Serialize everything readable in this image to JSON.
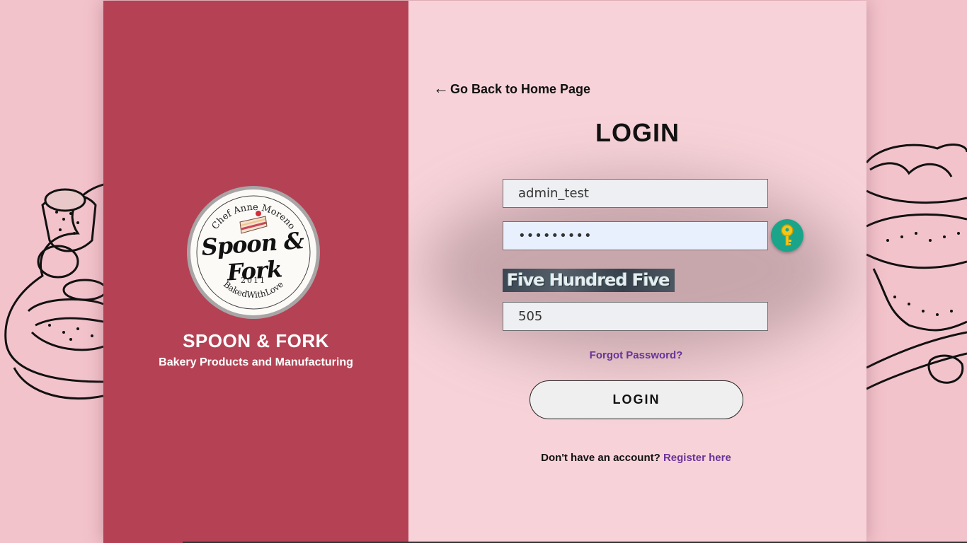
{
  "brand": {
    "logo": {
      "arc_top": "Chef Anne Moreno",
      "script": "Spoon & Fork",
      "year": "2011",
      "arc_bottom": "BakedWithLove"
    },
    "name": "SPOON & FORK",
    "tagline": "Bakery Products and Manufacturing",
    "color": "#b54254"
  },
  "form": {
    "back_link": "Go Back to Home Page",
    "back_arrow": "←",
    "title": "LOGIN",
    "username_value": "admin_test",
    "password_value": "•••••••••",
    "password_toggle_icon": "key-icon",
    "captcha_text": "Five Hundred Five",
    "captcha_value": "505",
    "forgot_password": "Forgot Password?",
    "login_button": "LOGIN",
    "register_prompt": "Don't have an account?",
    "register_link": "Register here",
    "link_color": "#6a3399",
    "panel_color": "#f7d3d9"
  }
}
